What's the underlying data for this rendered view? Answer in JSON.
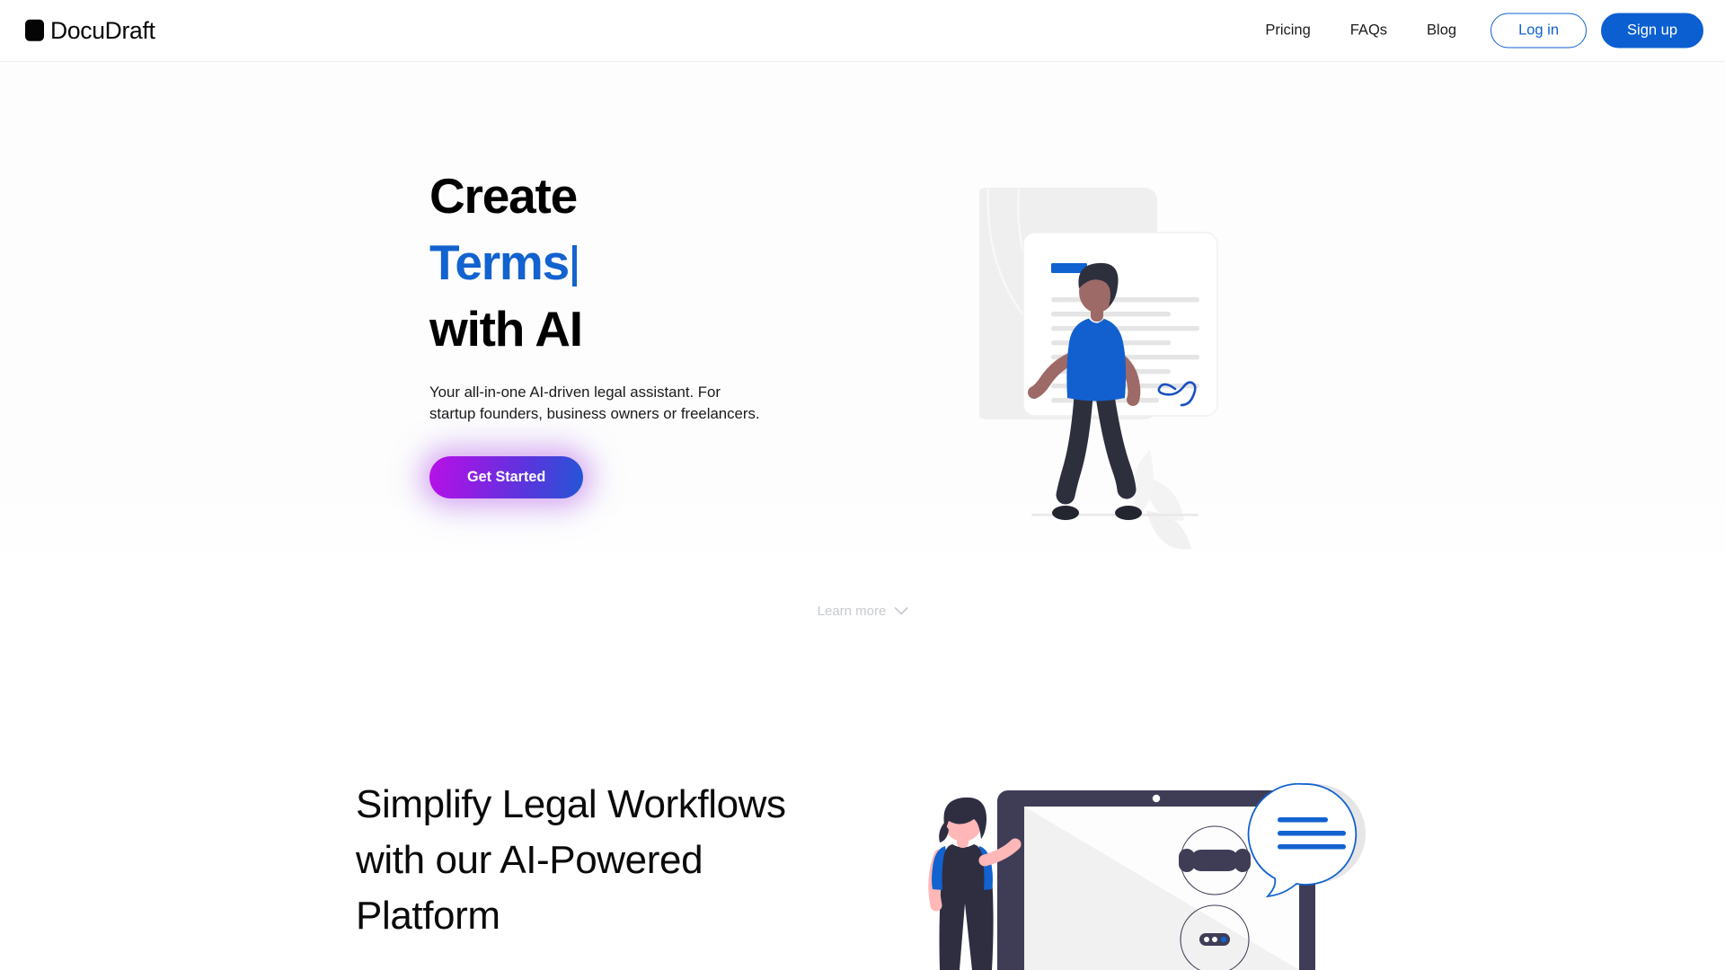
{
  "header": {
    "brand": {
      "name": "DocuDraft",
      "mark_icon": "square-logo-icon"
    },
    "nav": [
      {
        "label": "Pricing"
      },
      {
        "label": "FAQs"
      },
      {
        "label": "Blog"
      }
    ],
    "login_label": "Log in",
    "signup_label": "Sign up"
  },
  "hero": {
    "title_line1": "Create",
    "title_line2_accent": "Terms",
    "title_line3": "with AI",
    "subtitle": "Your all-in-one AI-driven legal assistant. For startup founders, business owners or freelancers.",
    "cta_label": "Get Started",
    "learn_more_label": "Learn more",
    "learn_more_icon": "chevron-down-icon",
    "illustration": "person-reviewing-documents-illustration"
  },
  "section2": {
    "heading": "Simplify Legal Workflows with our AI-Powered Platform",
    "illustration": "woman-with-chatbot-screen-illustration"
  },
  "colors": {
    "brand_blue": "#0c5fd0",
    "accent_blue": "#1262cf",
    "cta_gradient_start": "#b712e8",
    "cta_gradient_end": "#2456d6",
    "text_dark": "#0a0a0a",
    "muted_gray": "#c8cbd0",
    "pattern_gray": "#e9eaec"
  }
}
